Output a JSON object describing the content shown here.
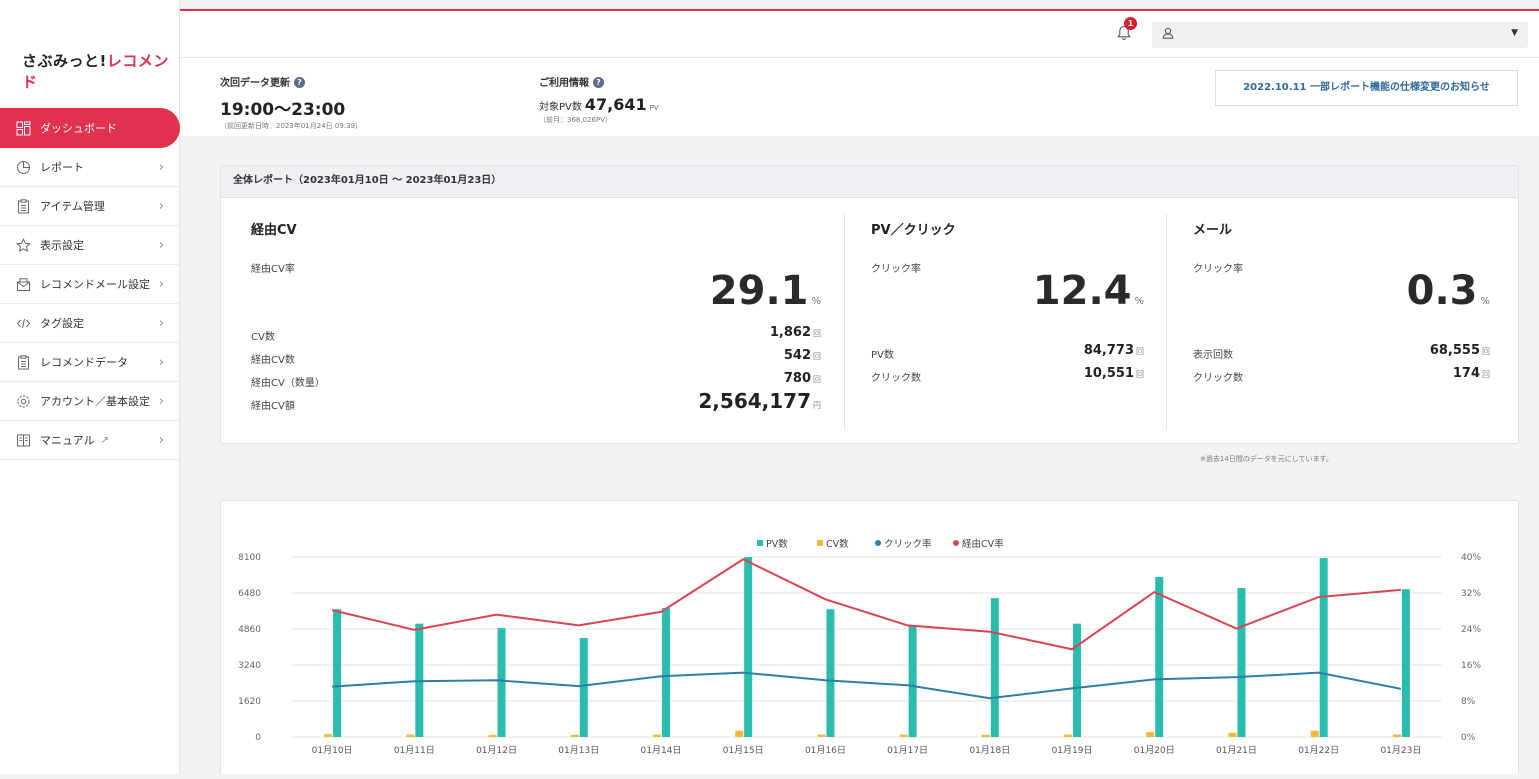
{
  "app": {
    "logo_main": "さぶみっと!",
    "logo_accent": "レコメンド"
  },
  "sidebar": {
    "items": [
      {
        "label": "ダッシュボード",
        "icon": "dashboard-icon",
        "active": true
      },
      {
        "label": "レポート",
        "icon": "pie-chart-icon"
      },
      {
        "label": "アイテム管理",
        "icon": "clipboard-icon"
      },
      {
        "label": "表示設定",
        "icon": "star-icon"
      },
      {
        "label": "レコメンドメール設定",
        "icon": "mail-icon"
      },
      {
        "label": "タグ設定",
        "icon": "code-icon"
      },
      {
        "label": "レコメンドデータ",
        "icon": "clipboard-icon"
      },
      {
        "label": "アカウント／基本設定",
        "icon": "gear-icon"
      },
      {
        "label": "マニュアル",
        "icon": "book-icon"
      }
    ]
  },
  "header": {
    "notification_count": "1",
    "user_value": ""
  },
  "info": {
    "next_update_label": "次回データ更新",
    "next_update_value": "19:00～23:00",
    "next_update_sub": "（前回更新日時：2023年01月24日 09:39）",
    "usage_label": "ご利用情報",
    "usage_prefix": "対象PV数",
    "usage_value": "47,641",
    "usage_unit": "PV",
    "usage_sub": "（前月：368,026PV）",
    "notice": "2022.10.11 一部レポート機能の仕様変更のお知らせ"
  },
  "report": {
    "title": "全体レポート（2023年01月10日 ～ 2023年01月23日）",
    "cv": {
      "title": "経由CV",
      "rate_label": "経由CV率",
      "rate": "29.1",
      "rate_unit": "%",
      "rows": [
        {
          "label": "CV数",
          "value": "1,862",
          "unit": "回"
        },
        {
          "label": "経由CV数",
          "value": "542",
          "unit": "回"
        },
        {
          "label": "経由CV（数量）",
          "value": "780",
          "unit": "回"
        },
        {
          "label": "経由CV額",
          "value": "2,564,177",
          "unit": "円"
        }
      ]
    },
    "pv": {
      "title": "PV／クリック",
      "rate_label": "クリック率",
      "rate": "12.4",
      "rate_unit": "%",
      "rows": [
        {
          "label": "PV数",
          "value": "84,773",
          "unit": "回"
        },
        {
          "label": "クリック数",
          "value": "10,551",
          "unit": "回"
        }
      ]
    },
    "mail": {
      "title": "メール",
      "rate_label": "クリック率",
      "rate": "0.3",
      "rate_unit": "%",
      "rows": [
        {
          "label": "表示回数",
          "value": "68,555",
          "unit": "回"
        },
        {
          "label": "クリック数",
          "value": "174",
          "unit": "回"
        }
      ]
    },
    "footnote": "※過去14日間のデータを元にしています。"
  },
  "chart_data": {
    "type": "bar",
    "categories": [
      "01月10日",
      "01月11日",
      "01月12日",
      "01月13日",
      "01月14日",
      "01月15日",
      "01月16日",
      "01月17日",
      "01月18日",
      "01月19日",
      "01月20日",
      "01月21日",
      "01月22日",
      "01月23日"
    ],
    "y_left": {
      "ticks": [
        "0",
        "1620",
        "3240",
        "4860",
        "6480",
        "8100"
      ],
      "min": 0,
      "max": 8100
    },
    "y_right": {
      "ticks": [
        "0%",
        "8%",
        "16%",
        "24%",
        "32%",
        "40%"
      ],
      "min": 0,
      "max": 40
    },
    "grid": true,
    "legend_position": "top",
    "series": [
      {
        "name": "PV数",
        "type": "bar",
        "axis": "left",
        "color": "#2bbcb0",
        "values": [
          5750,
          5100,
          4900,
          4450,
          5800,
          8100,
          5750,
          5000,
          6250,
          5100,
          7200,
          6700,
          8050,
          6650
        ]
      },
      {
        "name": "CV数",
        "type": "bar",
        "axis": "left",
        "color": "#f2b93b",
        "values": [
          130,
          110,
          95,
          100,
          110,
          280,
          110,
          110,
          100,
          110,
          230,
          190,
          280,
          110
        ]
      },
      {
        "name": "クリック率",
        "type": "line",
        "axis": "right",
        "color": "#2e7ea6",
        "values": [
          11.2,
          12.4,
          12.6,
          11.3,
          13.5,
          14.3,
          12.6,
          11.5,
          8.6,
          10.8,
          12.8,
          13.3,
          14.3,
          10.7
        ]
      },
      {
        "name": "経由CV率",
        "type": "line",
        "axis": "right",
        "color": "#d94452",
        "values": [
          28.2,
          23.8,
          27.2,
          24.8,
          27.8,
          39.5,
          30.6,
          24.8,
          23.4,
          19.5,
          32.2,
          24.1,
          31.1,
          32.7
        ]
      }
    ]
  }
}
